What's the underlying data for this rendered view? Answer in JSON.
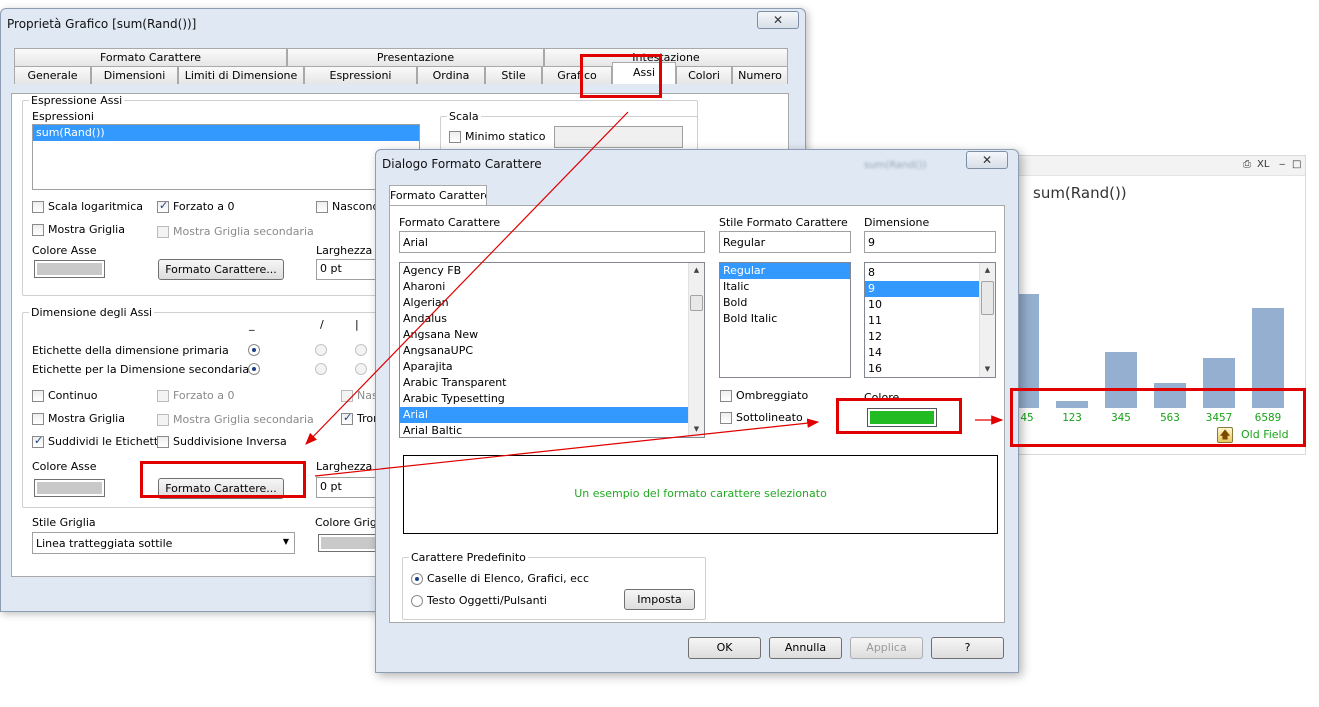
{
  "chart_window": {
    "title": "sum(Rand())",
    "caption_icons": [
      "⎙",
      "XL",
      "‒",
      "□"
    ],
    "bars": [
      {
        "label": "45",
        "value": 45
      },
      {
        "label": "123",
        "value": 123
      },
      {
        "label": "345",
        "value": 345
      },
      {
        "label": "563",
        "value": 563
      },
      {
        "label": "3457",
        "value": 3457
      },
      {
        "label": "6589",
        "value": 6589
      }
    ],
    "legend_text": "Old Field",
    "label_color": "#1aa31a",
    "bar_color": "#94afcf"
  },
  "main_window": {
    "title": "Proprietà Grafico [sum(Rand())]",
    "close_glyph": "✕",
    "tabs_back": [
      "Formato Carattere",
      "Presentazione",
      "Intestazione"
    ],
    "tabs_front": [
      "Generale",
      "Dimensioni",
      "Limiti di Dimensione",
      "Espressioni",
      "Ordina",
      "Stile",
      "Grafico",
      "Assi",
      "Colori",
      "Numero"
    ],
    "selected_tab": "Assi",
    "axis_expr": {
      "group_label": "Espressione Assi",
      "list_label": "Espressioni",
      "list_items": [
        "sum(Rand())"
      ],
      "scala_label": "Scala",
      "minimo_statico": "Minimo statico",
      "scala_log": "Scala logaritmica",
      "forzato": "Forzato a 0",
      "nascondi": "Nascondi",
      "mostra_griglia": "Mostra Griglia",
      "mostra_griglia_sec": "Mostra Griglia secondaria",
      "colore_asse": "Colore Asse",
      "formato_btn": "Formato Carattere...",
      "larghezza": "Larghezza",
      "larghezza_value": "0 pt"
    },
    "dim_axes": {
      "group_label": "Dimensione degli Assi",
      "col_headers": [
        "_",
        "/",
        "|"
      ],
      "etichette_primaria": "Etichette della dimensione primaria",
      "etichette_secondaria": "Etichette per la Dimensione secondaria",
      "continuo": "Continuo",
      "forzato": "Forzato a 0",
      "nascondi_cut": "Nas",
      "mostra_griglia": "Mostra Griglia",
      "mostra_griglia_sec": "Mostra Griglia secondaria",
      "tronca_cut": "Tron",
      "suddividi": "Suddividi le Etichette",
      "suddivisione_inversa": "Suddivisione Inversa",
      "colore_asse": "Colore Asse",
      "formato_btn": "Formato Carattere...",
      "larghezza": "Larghezza",
      "larghezza_value": "0 pt"
    },
    "stile_griglia_label": "Stile Griglia",
    "stile_griglia_value": "Linea tratteggiata sottile",
    "colore_griglia_label": "Colore Griglia"
  },
  "font_dialog": {
    "title": "Dialogo Formato Carattere",
    "title_extra": "sum(Rand())",
    "close_glyph": "✕",
    "tab": "Formato Carattere",
    "font_label": "Formato Carattere",
    "font_value": "Arial",
    "fonts": [
      "Agency FB",
      "Aharoni",
      "Algerian",
      "Andalus",
      "Angsana New",
      "AngsanaUPC",
      "Aparajita",
      "Arabic Transparent",
      "Arabic Typesetting",
      "Arial",
      "Arial Baltic"
    ],
    "selected_font": "Arial",
    "style_label": "Stile Formato Carattere",
    "style_value": "Regular",
    "styles": [
      "Regular",
      "Italic",
      "Bold",
      "Bold Italic"
    ],
    "size_label": "Dimensione",
    "size_value": "9",
    "sizes": [
      "8",
      "9",
      "10",
      "11",
      "12",
      "14",
      "16"
    ],
    "ombreggiato": "Ombreggiato",
    "sottolineato": "Sottolineato",
    "colore_label": "Colore",
    "colore_value": "#22bb22",
    "sample_text": "Un esempio del formato carattere selezionato",
    "sample_color": "#22aa22",
    "predef_group": "Carattere Predefinito",
    "predef_opt1": "Caselle di Elenco, Grafici, ecc",
    "predef_opt2": "Testo Oggetti/Pulsanti",
    "imposta": "Imposta",
    "ok": "OK",
    "annulla": "Annulla",
    "applica": "Applica",
    "help": "?"
  }
}
